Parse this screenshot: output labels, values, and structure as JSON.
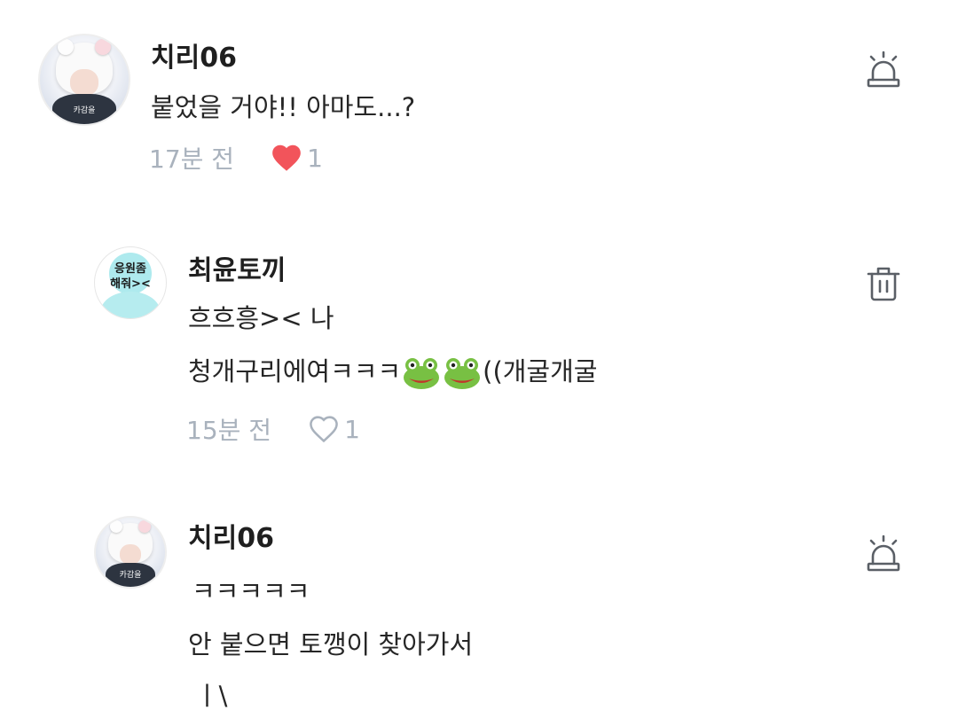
{
  "comments": [
    {
      "username": "치리06",
      "avatar_caption": "카감을",
      "lines": [
        "붙었을 거야!! 아마도...?"
      ],
      "time": "17분 전",
      "liked": true,
      "likes": "1",
      "action_icon": "siren-report-icon"
    },
    {
      "username": "최윤토끼",
      "avatar_sign": [
        "응원좀",
        "해줘><"
      ],
      "lines": [
        "흐흐흥>< 나",
        "청개구리에여ㅋㅋㅋ",
        "((개굴개굴"
      ],
      "time": "15분 전",
      "liked": false,
      "likes": "1",
      "action_icon": "trash-icon"
    },
    {
      "username": "치리06",
      "avatar_caption": "카감을",
      "lines": [
        "ㅋㅋㅋㅋㅋ",
        "안 붙으면 토깽이 찾아가서",
        "ㅣ\\"
      ],
      "action_icon": "siren-report-icon"
    }
  ],
  "colors": {
    "heart_filled": "#f2545b",
    "meta_text": "#a9b2bd",
    "icon_stroke": "#5a5f66",
    "frog_green": "#78c043"
  }
}
